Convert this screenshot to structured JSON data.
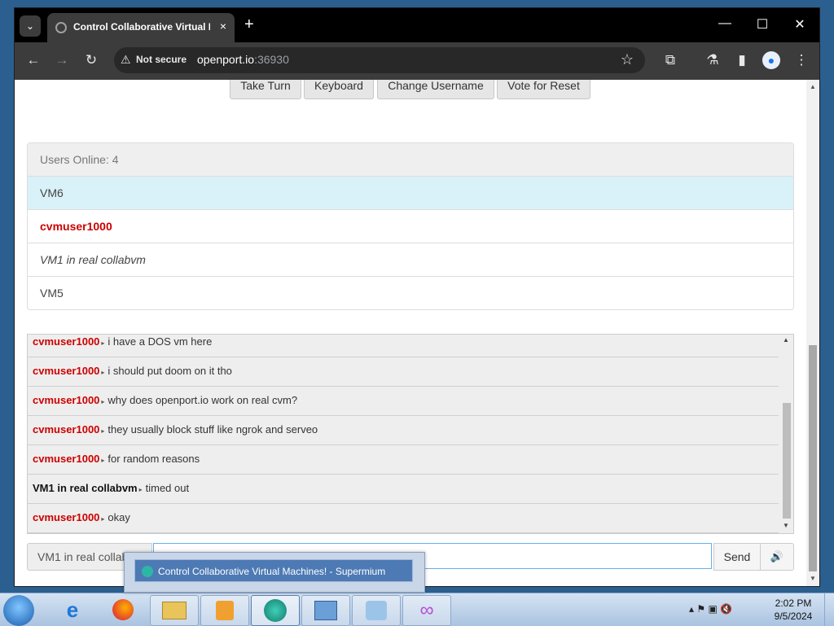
{
  "browser": {
    "tab_title": "Control Collaborative Virtual Machines!",
    "new_tab": "+",
    "tab_close": "×",
    "security_label": "Not secure",
    "url_host": "openport.io",
    "url_port": ":36930",
    "minimize": "—",
    "maximize": "☐",
    "close": "✕"
  },
  "page": {
    "buttons": [
      {
        "label": "Take Turn"
      },
      {
        "label": "Keyboard"
      },
      {
        "label": "Change Username"
      },
      {
        "label": "Vote for Reset"
      }
    ],
    "users_header": "Users Online: 4",
    "users": [
      {
        "name": "VM6",
        "style": "active"
      },
      {
        "name": "cvmuser1000",
        "style": "red"
      },
      {
        "name": "VM1 in real collabvm",
        "style": "italic"
      },
      {
        "name": "VM5",
        "style": "normal"
      }
    ],
    "chat": [
      {
        "user": "cvmuser1000",
        "text": "i have a DOS vm here",
        "color": "red"
      },
      {
        "user": "cvmuser1000",
        "text": "i should put doom on it tho",
        "color": "red"
      },
      {
        "user": "cvmuser1000",
        "text": "why does openport.io work on real cvm?",
        "color": "red"
      },
      {
        "user": "cvmuser1000",
        "text": "they usually block stuff like ngrok and serveo",
        "color": "red"
      },
      {
        "user": "cvmuser1000",
        "text": "for random reasons",
        "color": "red"
      },
      {
        "user": "VM1 in real collabvm",
        "text": "timed out",
        "color": "black"
      },
      {
        "user": "cvmuser1000",
        "text": "okay",
        "color": "red"
      }
    ],
    "username_label": "VM1 in real collabvm",
    "chat_input_value": "",
    "send_label": "Send",
    "volume_icon": "🔊"
  },
  "taskbar": {
    "preview_title": "Control Collaborative Virtual Machines! - Supermium",
    "time": "2:02 PM",
    "date": "9/5/2024"
  },
  "colors": {
    "red_user": "#cc0000",
    "active_row": "#d9f1f8",
    "browser_dark": "#3c3c3c"
  }
}
